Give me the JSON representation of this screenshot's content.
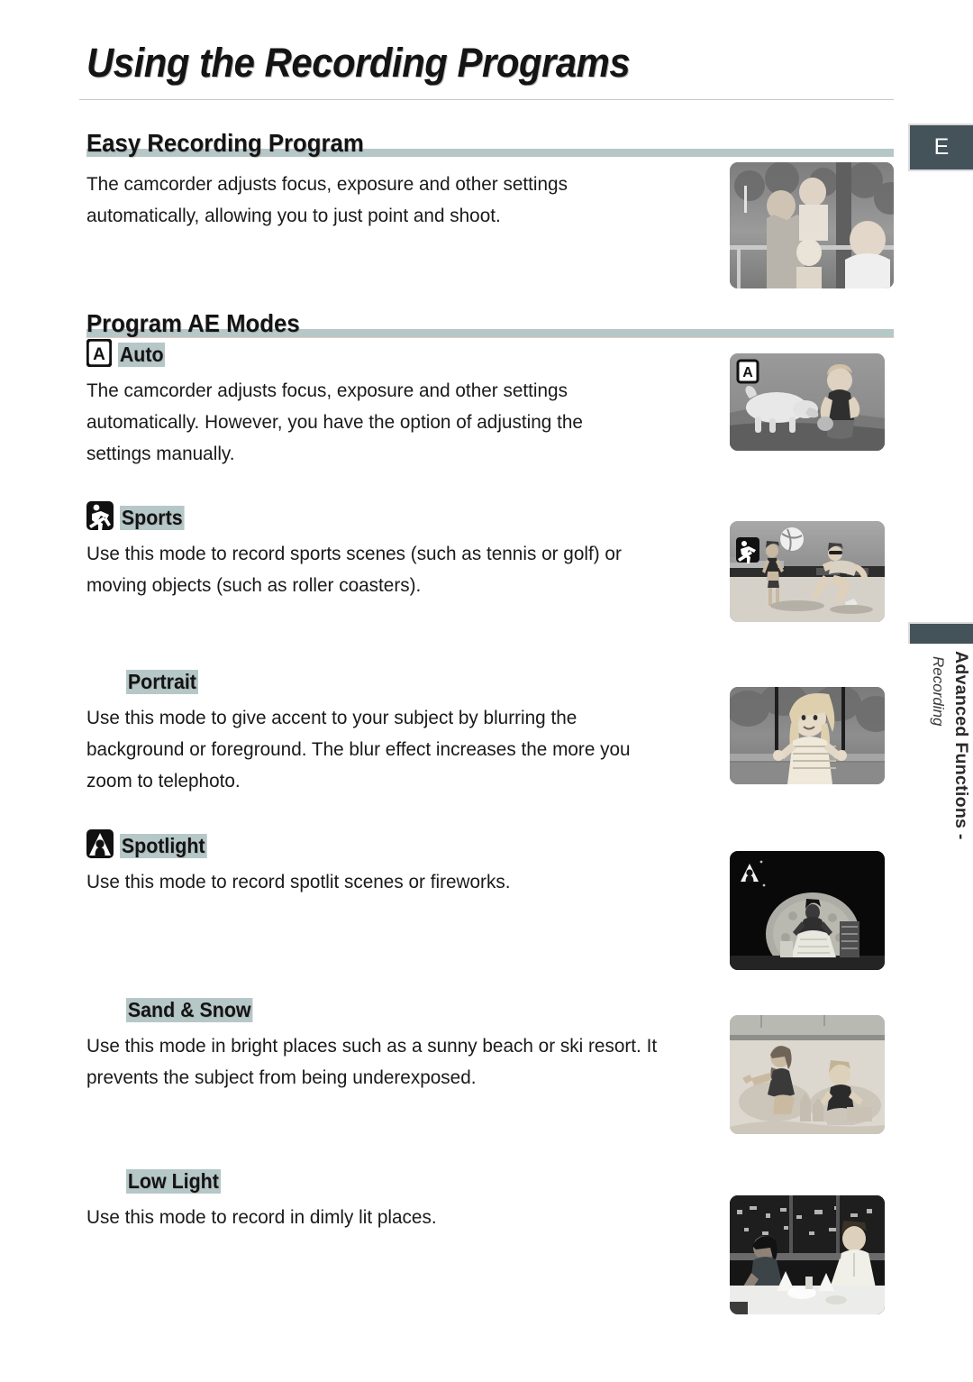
{
  "page": {
    "title": "Using the Recording Programs",
    "edge_tab_letter": "E",
    "side_tab_main": "Advanced Functions -",
    "side_tab_sub": "Recording"
  },
  "sections": [
    {
      "heading": "Easy Recording Program",
      "body": [
        "The camcorder adjusts focus, exposure and other settings",
        "automatically, allowing you to just point and shoot."
      ]
    },
    {
      "heading": "Program AE Modes"
    }
  ],
  "modes": [
    {
      "label": "Auto",
      "icon": "auto-mode-icon",
      "has_icon": true,
      "indented": false,
      "body": [
        "The camcorder adjusts focus, exposure and other settings",
        "automatically. However, you have the option of adjusting the",
        "settings manually."
      ],
      "photo": "photo-boy-with-dog",
      "photo_badge": "auto-mode-icon"
    },
    {
      "label": "Sports",
      "icon": "sports-mode-icon",
      "has_icon": true,
      "indented": false,
      "body": [
        "Use this mode to record sports scenes (such as tennis or golf) or",
        "moving objects (such as roller coasters)."
      ],
      "photo": "photo-beach-volleyball",
      "photo_badge": "sports-mode-icon"
    },
    {
      "label": "Portrait",
      "icon": "portrait-mode-icon",
      "has_icon": false,
      "indented": true,
      "body": [
        "Use this mode to give accent to your subject by blurring the",
        "background or foreground. The blur effect increases the more you",
        "zoom to telephoto."
      ],
      "photo": "photo-girl-on-swing",
      "photo_badge": ""
    },
    {
      "label": "Spotlight",
      "icon": "spotlight-mode-icon",
      "has_icon": true,
      "indented": false,
      "body": [
        "Use this mode to record spotlit scenes or fireworks."
      ],
      "photo": "photo-stage-performer",
      "photo_badge": "spotlight-mode-icon"
    },
    {
      "label": "Sand & Snow",
      "icon": "sand-snow-mode-icon",
      "has_icon": false,
      "indented": true,
      "body": [
        "Use this mode in bright places such as a sunny beach or ski resort. It",
        "prevents the subject from being underexposed."
      ],
      "photo": "photo-children-on-sand",
      "photo_badge": ""
    },
    {
      "label": "Low Light",
      "icon": "low-light-mode-icon",
      "has_icon": false,
      "indented": true,
      "body": [
        "Use this mode to record in dimly lit places."
      ],
      "photo": "photo-couple-at-night",
      "photo_badge": ""
    }
  ],
  "colors": {
    "highlight_bar": "#b6c7c7",
    "tab_dark": "#44535a",
    "rule": "#c9c9c9",
    "section_underline": "#e8c9c3"
  }
}
